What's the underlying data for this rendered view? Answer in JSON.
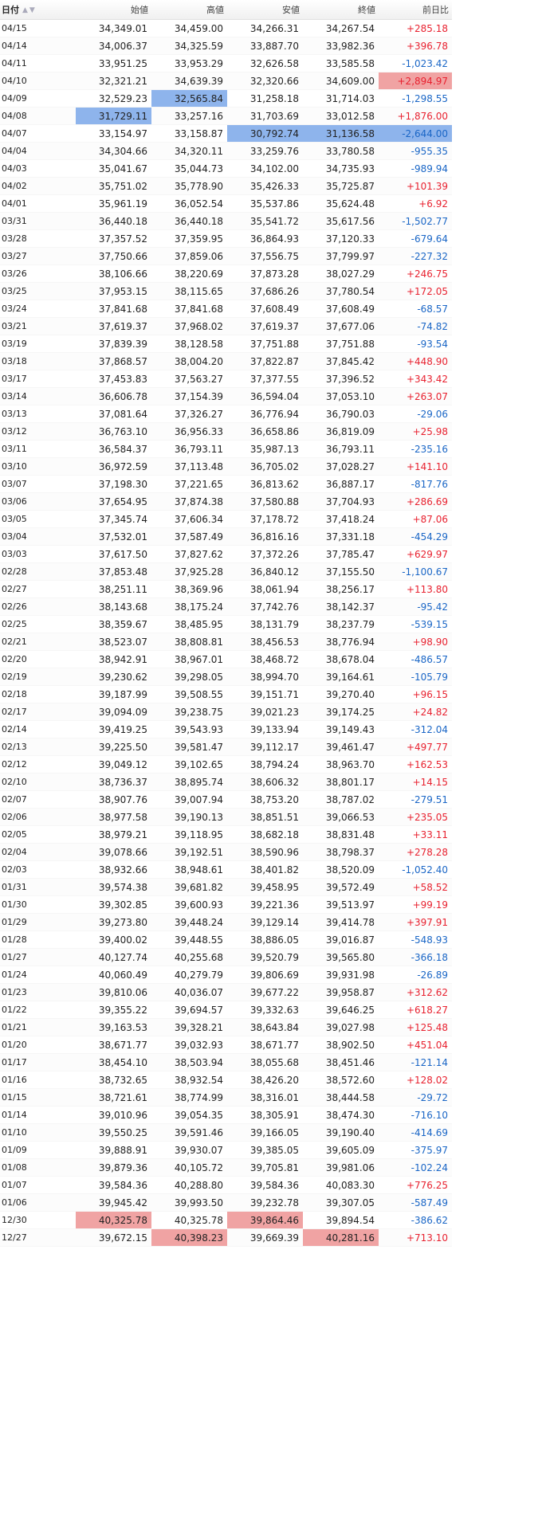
{
  "headers": {
    "date": "日付",
    "open": "始値",
    "high": "高値",
    "low": "安値",
    "close": "終値",
    "change": "前日比"
  },
  "colors": {
    "up": "#e8212f",
    "down": "#1a66c6",
    "highlight_blue": "#8eb4ec",
    "highlight_red": "#f0a3a3"
  },
  "rows": [
    {
      "date": "04/15",
      "open": "34,349.01",
      "high": "34,459.00",
      "low": "34,266.31",
      "close": "34,267.54",
      "change": "+285.18"
    },
    {
      "date": "04/14",
      "open": "34,006.37",
      "high": "34,325.59",
      "low": "33,887.70",
      "close": "33,982.36",
      "change": "+396.78"
    },
    {
      "date": "04/11",
      "open": "33,951.25",
      "high": "33,953.29",
      "low": "32,626.58",
      "close": "33,585.58",
      "change": "-1,023.42"
    },
    {
      "date": "04/10",
      "open": "32,321.21",
      "high": "34,639.39",
      "low": "32,320.66",
      "close": "34,609.00",
      "change": "+2,894.97"
    },
    {
      "date": "04/09",
      "open": "32,529.23",
      "high": "32,565.84",
      "low": "31,258.18",
      "close": "31,714.03",
      "change": "-1,298.55"
    },
    {
      "date": "04/08",
      "open": "31,729.11",
      "high": "33,257.16",
      "low": "31,703.69",
      "close": "33,012.58",
      "change": "+1,876.00"
    },
    {
      "date": "04/07",
      "open": "33,154.97",
      "high": "33,158.87",
      "low": "30,792.74",
      "close": "31,136.58",
      "change": "-2,644.00"
    },
    {
      "date": "04/04",
      "open": "34,304.66",
      "high": "34,320.11",
      "low": "33,259.76",
      "close": "33,780.58",
      "change": "-955.35"
    },
    {
      "date": "04/03",
      "open": "35,041.67",
      "high": "35,044.73",
      "low": "34,102.00",
      "close": "34,735.93",
      "change": "-989.94"
    },
    {
      "date": "04/02",
      "open": "35,751.02",
      "high": "35,778.90",
      "low": "35,426.33",
      "close": "35,725.87",
      "change": "+101.39"
    },
    {
      "date": "04/01",
      "open": "35,961.19",
      "high": "36,052.54",
      "low": "35,537.86",
      "close": "35,624.48",
      "change": "+6.92"
    },
    {
      "date": "03/31",
      "open": "36,440.18",
      "high": "36,440.18",
      "low": "35,541.72",
      "close": "35,617.56",
      "change": "-1,502.77"
    },
    {
      "date": "03/28",
      "open": "37,357.52",
      "high": "37,359.95",
      "low": "36,864.93",
      "close": "37,120.33",
      "change": "-679.64"
    },
    {
      "date": "03/27",
      "open": "37,750.66",
      "high": "37,859.06",
      "low": "37,556.75",
      "close": "37,799.97",
      "change": "-227.32"
    },
    {
      "date": "03/26",
      "open": "38,106.66",
      "high": "38,220.69",
      "low": "37,873.28",
      "close": "38,027.29",
      "change": "+246.75"
    },
    {
      "date": "03/25",
      "open": "37,953.15",
      "high": "38,115.65",
      "low": "37,686.26",
      "close": "37,780.54",
      "change": "+172.05"
    },
    {
      "date": "03/24",
      "open": "37,841.68",
      "high": "37,841.68",
      "low": "37,608.49",
      "close": "37,608.49",
      "change": "-68.57"
    },
    {
      "date": "03/21",
      "open": "37,619.37",
      "high": "37,968.02",
      "low": "37,619.37",
      "close": "37,677.06",
      "change": "-74.82"
    },
    {
      "date": "03/19",
      "open": "37,839.39",
      "high": "38,128.58",
      "low": "37,751.88",
      "close": "37,751.88",
      "change": "-93.54"
    },
    {
      "date": "03/18",
      "open": "37,868.57",
      "high": "38,004.20",
      "low": "37,822.87",
      "close": "37,845.42",
      "change": "+448.90"
    },
    {
      "date": "03/17",
      "open": "37,453.83",
      "high": "37,563.27",
      "low": "37,377.55",
      "close": "37,396.52",
      "change": "+343.42"
    },
    {
      "date": "03/14",
      "open": "36,606.78",
      "high": "37,154.39",
      "low": "36,594.04",
      "close": "37,053.10",
      "change": "+263.07"
    },
    {
      "date": "03/13",
      "open": "37,081.64",
      "high": "37,326.27",
      "low": "36,776.94",
      "close": "36,790.03",
      "change": "-29.06"
    },
    {
      "date": "03/12",
      "open": "36,763.10",
      "high": "36,956.33",
      "low": "36,658.86",
      "close": "36,819.09",
      "change": "+25.98"
    },
    {
      "date": "03/11",
      "open": "36,584.37",
      "high": "36,793.11",
      "low": "35,987.13",
      "close": "36,793.11",
      "change": "-235.16"
    },
    {
      "date": "03/10",
      "open": "36,972.59",
      "high": "37,113.48",
      "low": "36,705.02",
      "close": "37,028.27",
      "change": "+141.10"
    },
    {
      "date": "03/07",
      "open": "37,198.30",
      "high": "37,221.65",
      "low": "36,813.62",
      "close": "36,887.17",
      "change": "-817.76"
    },
    {
      "date": "03/06",
      "open": "37,654.95",
      "high": "37,874.38",
      "low": "37,580.88",
      "close": "37,704.93",
      "change": "+286.69"
    },
    {
      "date": "03/05",
      "open": "37,345.74",
      "high": "37,606.34",
      "low": "37,178.72",
      "close": "37,418.24",
      "change": "+87.06"
    },
    {
      "date": "03/04",
      "open": "37,532.01",
      "high": "37,587.49",
      "low": "36,816.16",
      "close": "37,331.18",
      "change": "-454.29"
    },
    {
      "date": "03/03",
      "open": "37,617.50",
      "high": "37,827.62",
      "low": "37,372.26",
      "close": "37,785.47",
      "change": "+629.97"
    },
    {
      "date": "02/28",
      "open": "37,853.48",
      "high": "37,925.28",
      "low": "36,840.12",
      "close": "37,155.50",
      "change": "-1,100.67"
    },
    {
      "date": "02/27",
      "open": "38,251.11",
      "high": "38,369.96",
      "low": "38,061.94",
      "close": "38,256.17",
      "change": "+113.80"
    },
    {
      "date": "02/26",
      "open": "38,143.68",
      "high": "38,175.24",
      "low": "37,742.76",
      "close": "38,142.37",
      "change": "-95.42"
    },
    {
      "date": "02/25",
      "open": "38,359.67",
      "high": "38,485.95",
      "low": "38,131.79",
      "close": "38,237.79",
      "change": "-539.15"
    },
    {
      "date": "02/21",
      "open": "38,523.07",
      "high": "38,808.81",
      "low": "38,456.53",
      "close": "38,776.94",
      "change": "+98.90"
    },
    {
      "date": "02/20",
      "open": "38,942.91",
      "high": "38,967.01",
      "low": "38,468.72",
      "close": "38,678.04",
      "change": "-486.57"
    },
    {
      "date": "02/19",
      "open": "39,230.62",
      "high": "39,298.05",
      "low": "38,994.70",
      "close": "39,164.61",
      "change": "-105.79"
    },
    {
      "date": "02/18",
      "open": "39,187.99",
      "high": "39,508.55",
      "low": "39,151.71",
      "close": "39,270.40",
      "change": "+96.15"
    },
    {
      "date": "02/17",
      "open": "39,094.09",
      "high": "39,238.75",
      "low": "39,021.23",
      "close": "39,174.25",
      "change": "+24.82"
    },
    {
      "date": "02/14",
      "open": "39,419.25",
      "high": "39,543.93",
      "low": "39,133.94",
      "close": "39,149.43",
      "change": "-312.04"
    },
    {
      "date": "02/13",
      "open": "39,225.50",
      "high": "39,581.47",
      "low": "39,112.17",
      "close": "39,461.47",
      "change": "+497.77"
    },
    {
      "date": "02/12",
      "open": "39,049.12",
      "high": "39,102.65",
      "low": "38,794.24",
      "close": "38,963.70",
      "change": "+162.53"
    },
    {
      "date": "02/10",
      "open": "38,736.37",
      "high": "38,895.74",
      "low": "38,606.32",
      "close": "38,801.17",
      "change": "+14.15"
    },
    {
      "date": "02/07",
      "open": "38,907.76",
      "high": "39,007.94",
      "low": "38,753.20",
      "close": "38,787.02",
      "change": "-279.51"
    },
    {
      "date": "02/06",
      "open": "38,977.58",
      "high": "39,190.13",
      "low": "38,851.51",
      "close": "39,066.53",
      "change": "+235.05"
    },
    {
      "date": "02/05",
      "open": "38,979.21",
      "high": "39,118.95",
      "low": "38,682.18",
      "close": "38,831.48",
      "change": "+33.11"
    },
    {
      "date": "02/04",
      "open": "39,078.66",
      "high": "39,192.51",
      "low": "38,590.96",
      "close": "38,798.37",
      "change": "+278.28"
    },
    {
      "date": "02/03",
      "open": "38,932.66",
      "high": "38,948.61",
      "low": "38,401.82",
      "close": "38,520.09",
      "change": "-1,052.40"
    },
    {
      "date": "01/31",
      "open": "39,574.38",
      "high": "39,681.82",
      "low": "39,458.95",
      "close": "39,572.49",
      "change": "+58.52"
    },
    {
      "date": "01/30",
      "open": "39,302.85",
      "high": "39,600.93",
      "low": "39,221.36",
      "close": "39,513.97",
      "change": "+99.19"
    },
    {
      "date": "01/29",
      "open": "39,273.80",
      "high": "39,448.24",
      "low": "39,129.14",
      "close": "39,414.78",
      "change": "+397.91"
    },
    {
      "date": "01/28",
      "open": "39,400.02",
      "high": "39,448.55",
      "low": "38,886.05",
      "close": "39,016.87",
      "change": "-548.93"
    },
    {
      "date": "01/27",
      "open": "40,127.74",
      "high": "40,255.68",
      "low": "39,520.79",
      "close": "39,565.80",
      "change": "-366.18"
    },
    {
      "date": "01/24",
      "open": "40,060.49",
      "high": "40,279.79",
      "low": "39,806.69",
      "close": "39,931.98",
      "change": "-26.89"
    },
    {
      "date": "01/23",
      "open": "39,810.06",
      "high": "40,036.07",
      "low": "39,677.22",
      "close": "39,958.87",
      "change": "+312.62"
    },
    {
      "date": "01/22",
      "open": "39,355.22",
      "high": "39,694.57",
      "low": "39,332.63",
      "close": "39,646.25",
      "change": "+618.27"
    },
    {
      "date": "01/21",
      "open": "39,163.53",
      "high": "39,328.21",
      "low": "38,643.84",
      "close": "39,027.98",
      "change": "+125.48"
    },
    {
      "date": "01/20",
      "open": "38,671.77",
      "high": "39,032.93",
      "low": "38,671.77",
      "close": "38,902.50",
      "change": "+451.04"
    },
    {
      "date": "01/17",
      "open": "38,454.10",
      "high": "38,503.94",
      "low": "38,055.68",
      "close": "38,451.46",
      "change": "-121.14"
    },
    {
      "date": "01/16",
      "open": "38,732.65",
      "high": "38,932.54",
      "low": "38,426.20",
      "close": "38,572.60",
      "change": "+128.02"
    },
    {
      "date": "01/15",
      "open": "38,721.61",
      "high": "38,774.99",
      "low": "38,316.01",
      "close": "38,444.58",
      "change": "-29.72"
    },
    {
      "date": "01/14",
      "open": "39,010.96",
      "high": "39,054.35",
      "low": "38,305.91",
      "close": "38,474.30",
      "change": "-716.10"
    },
    {
      "date": "01/10",
      "open": "39,550.25",
      "high": "39,591.46",
      "low": "39,166.05",
      "close": "39,190.40",
      "change": "-414.69"
    },
    {
      "date": "01/09",
      "open": "39,888.91",
      "high": "39,930.07",
      "low": "39,385.05",
      "close": "39,605.09",
      "change": "-375.97"
    },
    {
      "date": "01/08",
      "open": "39,879.36",
      "high": "40,105.72",
      "low": "39,705.81",
      "close": "39,981.06",
      "change": "-102.24"
    },
    {
      "date": "01/07",
      "open": "39,584.36",
      "high": "40,288.80",
      "low": "39,584.36",
      "close": "40,083.30",
      "change": "+776.25"
    },
    {
      "date": "01/06",
      "open": "39,945.42",
      "high": "39,993.50",
      "low": "39,232.78",
      "close": "39,307.05",
      "change": "-587.49"
    },
    {
      "date": "12/30",
      "open": "40,325.78",
      "high": "40,325.78",
      "low": "39,864.46",
      "close": "39,894.54",
      "change": "-386.62"
    },
    {
      "date": "12/27",
      "open": "39,672.15",
      "high": "40,398.23",
      "low": "39,669.39",
      "close": "40,281.16",
      "change": "+713.10"
    }
  ],
  "highlights": {
    "blue": [
      [
        4,
        "high"
      ],
      [
        5,
        "open"
      ],
      [
        6,
        "low"
      ],
      [
        6,
        "close"
      ],
      [
        6,
        "change"
      ]
    ],
    "red": [
      [
        3,
        "change"
      ],
      [
        68,
        "open"
      ],
      [
        68,
        "low"
      ],
      [
        69,
        "high"
      ],
      [
        69,
        "close"
      ]
    ]
  }
}
